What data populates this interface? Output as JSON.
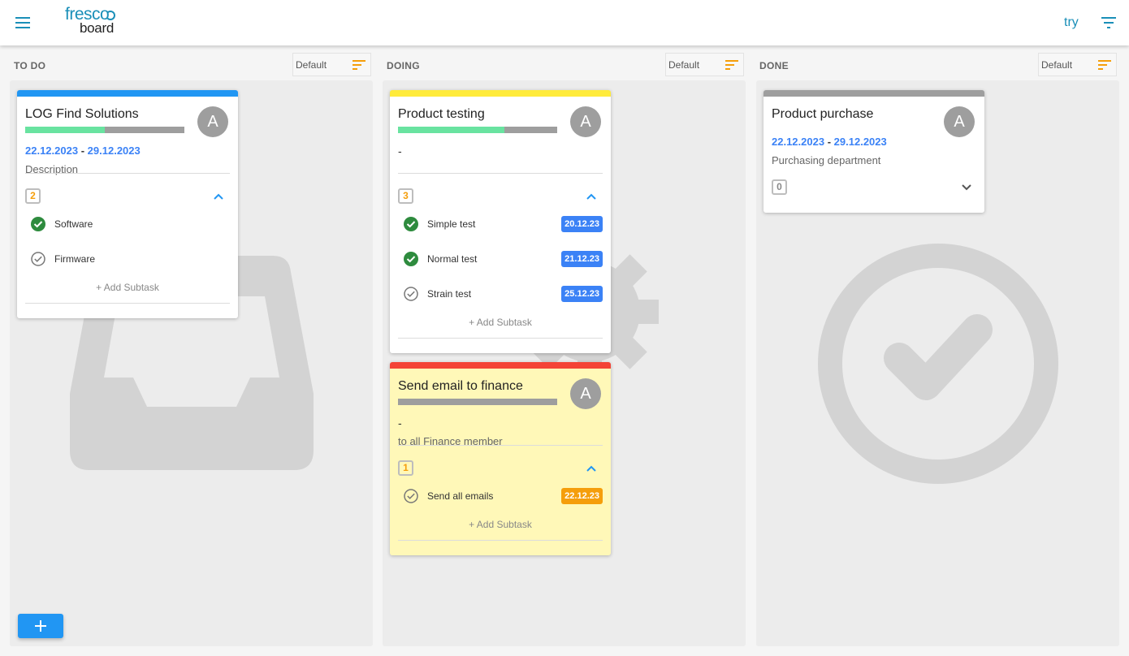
{
  "app": {
    "logo_top": "fresco",
    "logo_bottom": "board",
    "try_label": "try"
  },
  "columns": [
    {
      "title": "TO DO",
      "sort": "Default",
      "bg_icon": "inbox-tray-icon"
    },
    {
      "title": "DOING",
      "sort": "Default",
      "bg_icon": "gear-icon"
    },
    {
      "title": "DONE",
      "sort": "Default",
      "bg_icon": "check-circle-icon"
    }
  ],
  "cards": {
    "log": {
      "title": "LOG Find Solutions",
      "color": "#2196f3",
      "progress": 0.5,
      "avatar": "A",
      "date_start": "22.12.2023",
      "date_sep": "-",
      "date_end": "29.12.2023",
      "description": "Description",
      "count": "2",
      "subtasks": [
        {
          "label": "Software",
          "done": true
        },
        {
          "label": "Firmware",
          "done": false
        }
      ],
      "add_subtask": "+ Add Subtask"
    },
    "testing": {
      "title": "Product testing",
      "color": "#ffeb3b",
      "progress": 0.67,
      "avatar": "A",
      "dash": "-",
      "count": "3",
      "subtasks": [
        {
          "label": "Simple test",
          "done": true,
          "date": "20.12.23"
        },
        {
          "label": "Normal test",
          "done": true,
          "date": "21.12.23"
        },
        {
          "label": "Strain test",
          "done": false,
          "date": "25.12.23"
        }
      ],
      "add_subtask": "+ Add Subtask"
    },
    "email": {
      "title": "Send email to finance",
      "color": "#f44336",
      "progress": 0,
      "avatar": "A",
      "dash": "-",
      "description": "to all Finance member",
      "count": "1",
      "subtasks": [
        {
          "label": "Send all emails",
          "done": false,
          "date": "22.12.23"
        }
      ],
      "add_subtask": "+ Add Subtask"
    },
    "purchase": {
      "title": "Product purchase",
      "color": "#9e9e9e",
      "avatar": "A",
      "date_start": "22.12.2023",
      "date_sep": "-",
      "date_end": "29.12.2023",
      "description": "Purchasing department",
      "count": "0"
    }
  },
  "colors": {
    "accent": "#2196f3",
    "brand": "#1a8fb8",
    "sort_icon": "#f59e0b",
    "check_done": "#2e8b3e"
  }
}
